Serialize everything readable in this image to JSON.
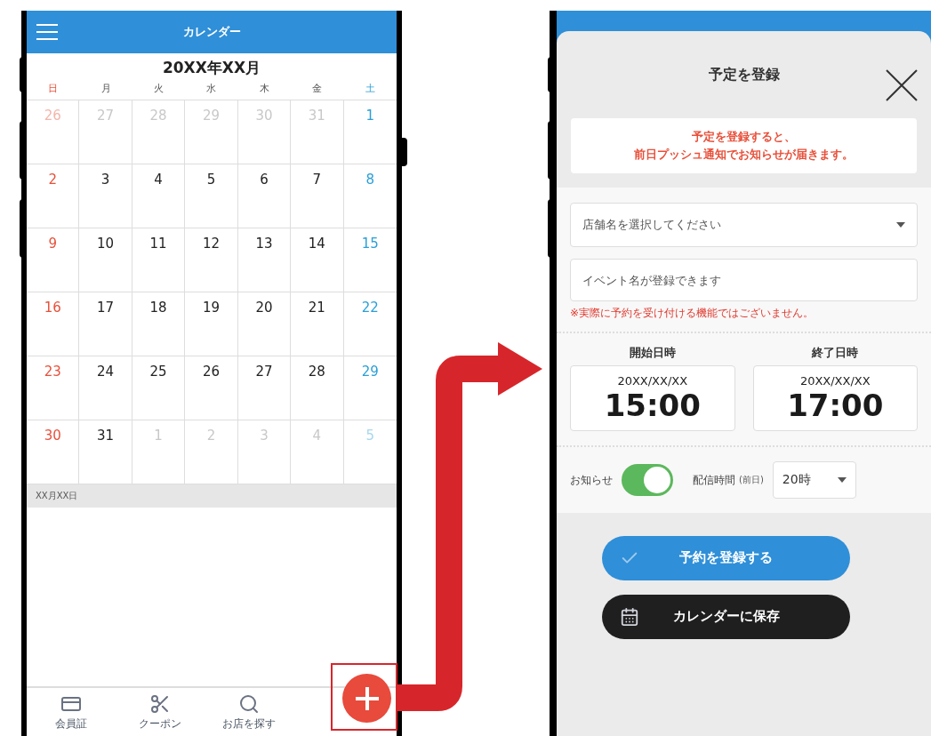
{
  "calendar_screen": {
    "header": {
      "title": "カレンダー"
    },
    "month_title": "20XX年XX月",
    "weekdays": [
      {
        "label": "日",
        "kind": "sunday"
      },
      {
        "label": "月",
        "kind": "weekday"
      },
      {
        "label": "火",
        "kind": "weekday"
      },
      {
        "label": "水",
        "kind": "weekday"
      },
      {
        "label": "木",
        "kind": "weekday"
      },
      {
        "label": "金",
        "kind": "weekday"
      },
      {
        "label": "土",
        "kind": "saturday"
      }
    ],
    "weeks": [
      [
        {
          "day": "26",
          "outside": true
        },
        {
          "day": "27",
          "outside": true
        },
        {
          "day": "28",
          "outside": true
        },
        {
          "day": "29",
          "outside": true
        },
        {
          "day": "30",
          "outside": true
        },
        {
          "day": "31",
          "outside": true
        },
        {
          "day": "1",
          "outside": false
        }
      ],
      [
        {
          "day": "2",
          "outside": false
        },
        {
          "day": "3",
          "outside": false
        },
        {
          "day": "4",
          "outside": false
        },
        {
          "day": "5",
          "outside": false
        },
        {
          "day": "6",
          "outside": false
        },
        {
          "day": "7",
          "outside": false
        },
        {
          "day": "8",
          "outside": false
        }
      ],
      [
        {
          "day": "9",
          "outside": false
        },
        {
          "day": "10",
          "outside": false
        },
        {
          "day": "11",
          "outside": false
        },
        {
          "day": "12",
          "outside": false
        },
        {
          "day": "13",
          "outside": false
        },
        {
          "day": "14",
          "outside": false
        },
        {
          "day": "15",
          "outside": false
        }
      ],
      [
        {
          "day": "16",
          "outside": false
        },
        {
          "day": "17",
          "outside": false
        },
        {
          "day": "18",
          "outside": false
        },
        {
          "day": "19",
          "outside": false
        },
        {
          "day": "20",
          "outside": false
        },
        {
          "day": "21",
          "outside": false
        },
        {
          "day": "22",
          "outside": false
        }
      ],
      [
        {
          "day": "23",
          "outside": false
        },
        {
          "day": "24",
          "outside": false
        },
        {
          "day": "25",
          "outside": false
        },
        {
          "day": "26",
          "outside": false
        },
        {
          "day": "27",
          "outside": false
        },
        {
          "day": "28",
          "outside": false
        },
        {
          "day": "29",
          "outside": false
        }
      ],
      [
        {
          "day": "30",
          "outside": false
        },
        {
          "day": "31",
          "outside": false
        },
        {
          "day": "1",
          "outside": true
        },
        {
          "day": "2",
          "outside": true
        },
        {
          "day": "3",
          "outside": true
        },
        {
          "day": "4",
          "outside": true
        },
        {
          "day": "5",
          "outside": true
        }
      ]
    ],
    "date_bar": "XX月XX日",
    "tab_bar": [
      {
        "label": "会員証",
        "kind": "card"
      },
      {
        "label": "クーポン",
        "kind": "coupon"
      },
      {
        "label": "お店を探す",
        "kind": "search"
      }
    ]
  },
  "register_modal": {
    "title": "予定を登録",
    "notice": [
      "予定を登録すると、",
      "前日プッシュ通知でお知らせが届きます。"
    ],
    "store_select": {
      "placeholder": "店舗名を選択してください"
    },
    "event_field": {
      "placeholder": "イベント名が登録できます"
    },
    "disclaimer": "※実際に予約を受け付ける機能ではございません。",
    "times": [
      {
        "label": "開始日時",
        "date": "20XX/XX/XX",
        "time": "15:00"
      },
      {
        "label": "終了日時",
        "date": "20XX/XX/XX",
        "time": "17:00"
      }
    ],
    "notification": {
      "label": "お知らせ",
      "on": true
    },
    "delivery": {
      "label": "配信時間",
      "sublabel": "(前日)",
      "value": "20時"
    },
    "buttons": [
      {
        "label": "予約を登録する",
        "kind": "primary"
      },
      {
        "label": "カレンダーに保存",
        "kind": "dark"
      }
    ]
  }
}
